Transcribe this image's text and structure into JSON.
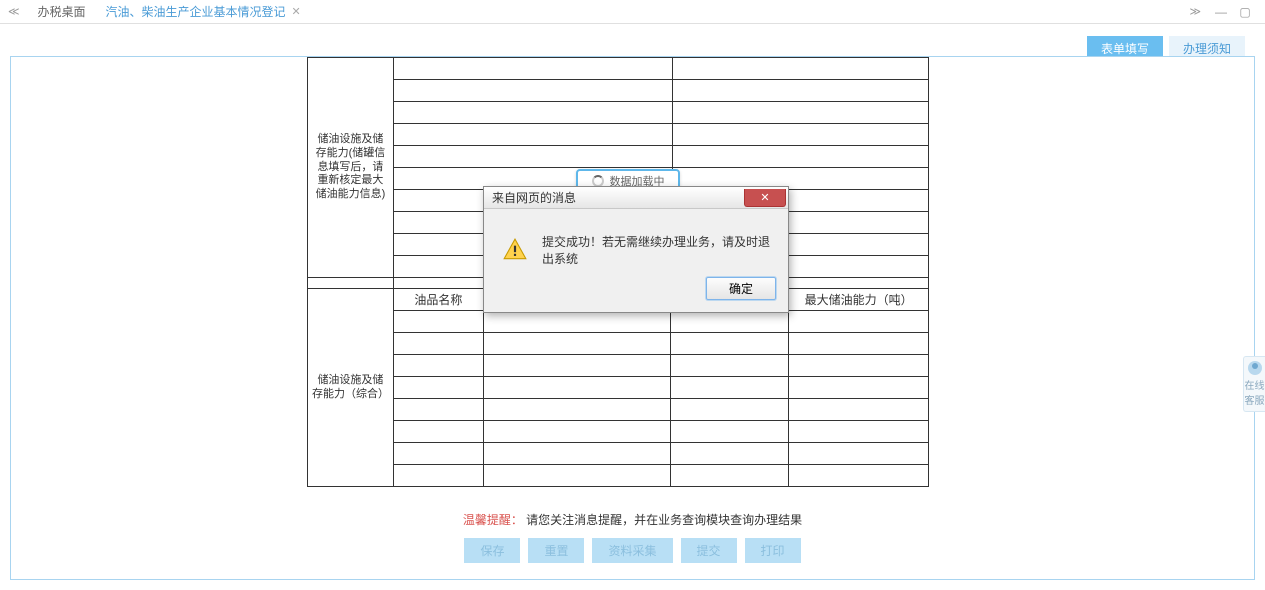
{
  "tabs": {
    "home": "办税桌面",
    "current": "汽油、柴油生产企业基本情况登记"
  },
  "actions": {
    "form_fill": "表单填写",
    "notice": "办理须知"
  },
  "table": {
    "section1_head": "储油设施及储存能力(储罐信息填写后，请重新核定最大储油能力信息)",
    "section2_head": "储油设施及储存能力（综合）",
    "col_oil_name": "油品名称",
    "col_max_capacity": "最大储油能力（吨）"
  },
  "loading": {
    "text": "数据加载中"
  },
  "dialog": {
    "title": "来自网页的消息",
    "message": "提交成功！若无需继续办理业务，请及时退出系统",
    "ok": "确定"
  },
  "footer": {
    "tip_label": "温馨提醒：",
    "tip_text": "请您关注消息提醒，并在业务查询模块查询办理结果",
    "btn_save": "保存",
    "btn_reset": "重置",
    "btn_preview": "资料采集",
    "btn_submit": "提交",
    "btn_print": "打印"
  },
  "side_help": {
    "label": "在线客服"
  }
}
